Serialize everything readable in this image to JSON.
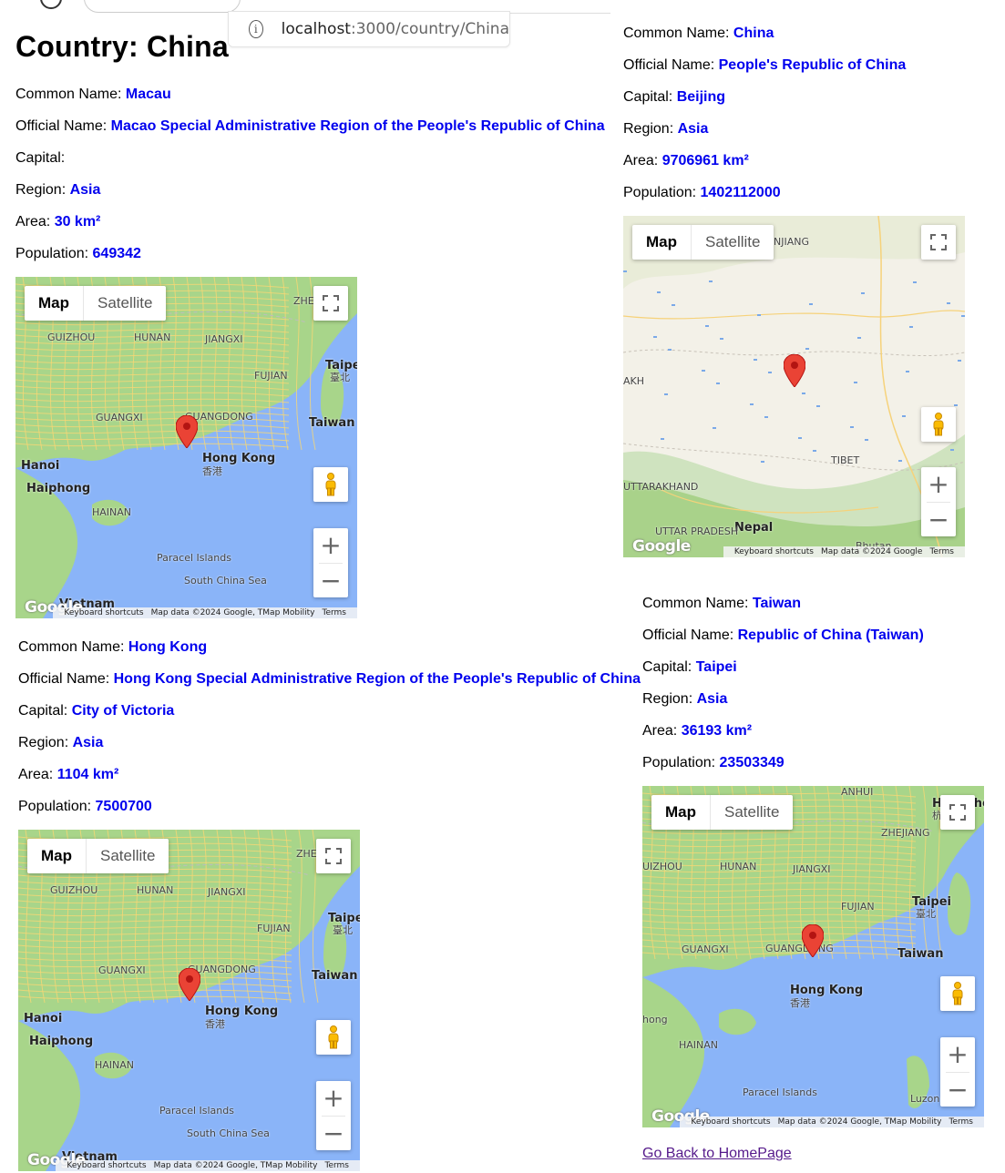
{
  "browser": {
    "url_host": "localhost",
    "url_path": ":3000/country/China"
  },
  "page_title": "Country: China",
  "labels": {
    "common": "Common Name: ",
    "official": "Official Name: ",
    "capital": "Capital:",
    "region": "Region: ",
    "area": "Area: ",
    "population": "Population: "
  },
  "countries": [
    {
      "common_name": "Macau",
      "official_name": "Macao Special Administrative Region of the People's Republic of China",
      "capital": "",
      "region": "Asia",
      "area": "30 km²",
      "population": "649342"
    },
    {
      "common_name": "China",
      "official_name": "People's Republic of China",
      "capital": "Beijing",
      "region": "Asia",
      "area": "9706961 km²",
      "population": "1402112000"
    },
    {
      "common_name": "Hong Kong",
      "official_name": "Hong Kong Special Administrative Region of the People's Republic of China",
      "capital": "City of Victoria",
      "region": "Asia",
      "area": "1104 km²",
      "population": "7500700"
    },
    {
      "common_name": "Taiwan",
      "official_name": "Republic of China (Taiwan)",
      "capital": "Taipei",
      "region": "Asia",
      "area": "36193 km²",
      "population": "23503349"
    }
  ],
  "map_controls": {
    "map": "Map",
    "satellite": "Satellite",
    "zoom_in": "+",
    "zoom_out": "−",
    "keyboard": "Keyboard shortcuts",
    "terms": "Terms",
    "google": "Google"
  },
  "map_footers": {
    "south": "Map data ©2024 Google, TMap Mobility",
    "china": "Map data ©2024 Google"
  },
  "map_labels": {
    "south": [
      "GUIZHOU",
      "HUNAN",
      "JIANGXI",
      "FUJIAN",
      "GUANGXI",
      "GUANGDONG",
      "Hong Kong",
      "香港",
      "Taiwan",
      "Taipei",
      "臺北",
      "Hanoi",
      "Haiphong",
      "HAINAN",
      "Paracel Islands",
      "South China Sea",
      "Vietnam",
      "ZHE"
    ],
    "china": [
      "NJIANG",
      "TIBET",
      "Nepal",
      "UTTAR PRADESH",
      "UTTARAKHAND",
      "AKH",
      "Bhutan"
    ],
    "taiwan_extra": [
      "ZHEJIANG",
      "ANHUI",
      "Hangzhou",
      "杭州市",
      "Luzon",
      "hong",
      "UIZHOU"
    ]
  },
  "back_link": "Go Back to HomePage",
  "colors": {
    "link_value": "#0000ee",
    "visited_link": "#551a8b",
    "sea": "#8ab4f8",
    "land": "#a8d58a"
  }
}
